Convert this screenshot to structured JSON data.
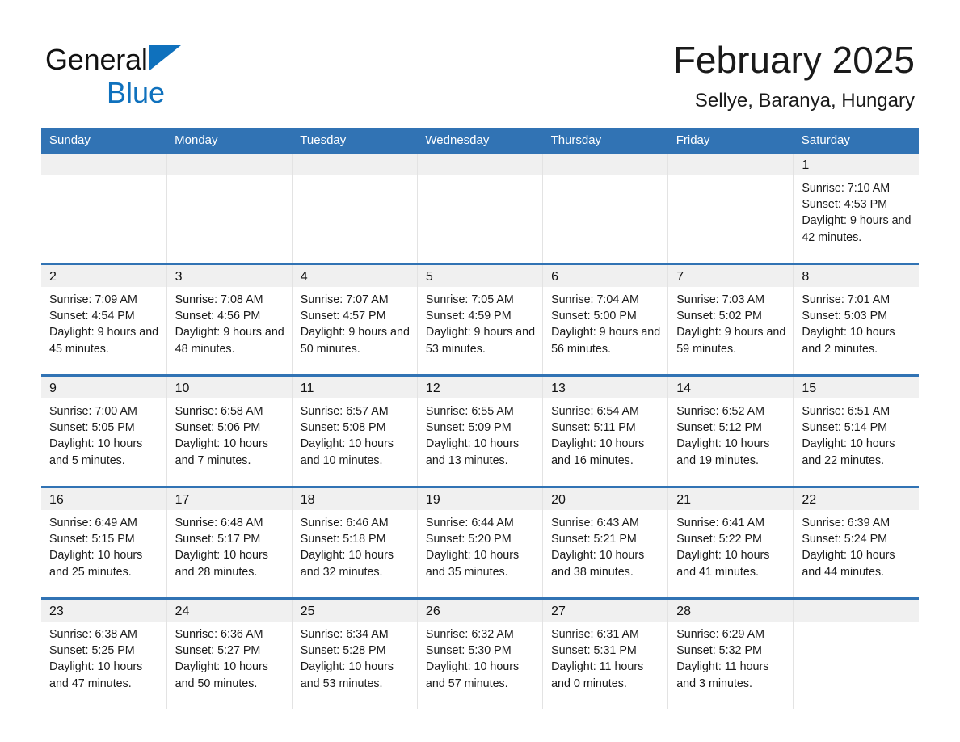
{
  "logo": {
    "word1": "General",
    "word2": "Blue",
    "triangle_icon": "triangle-icon",
    "blue": "#0f71bd"
  },
  "header": {
    "month_title": "February 2025",
    "location": "Sellye, Baranya, Hungary"
  },
  "colors": {
    "header_blue": "#3173b4",
    "row_divider_blue": "#3173b4",
    "daynum_band": "#f0f0f0",
    "text": "#1a1a1a"
  },
  "weekday_headers": [
    "Sunday",
    "Monday",
    "Tuesday",
    "Wednesday",
    "Thursday",
    "Friday",
    "Saturday"
  ],
  "weeks": [
    [
      {
        "day": "",
        "empty": true
      },
      {
        "day": "",
        "empty": true
      },
      {
        "day": "",
        "empty": true
      },
      {
        "day": "",
        "empty": true
      },
      {
        "day": "",
        "empty": true
      },
      {
        "day": "",
        "empty": true
      },
      {
        "day": "1",
        "sunrise": "Sunrise: 7:10 AM",
        "sunset": "Sunset: 4:53 PM",
        "daylight": "Daylight: 9 hours and 42 minutes."
      }
    ],
    [
      {
        "day": "2",
        "sunrise": "Sunrise: 7:09 AM",
        "sunset": "Sunset: 4:54 PM",
        "daylight": "Daylight: 9 hours and 45 minutes."
      },
      {
        "day": "3",
        "sunrise": "Sunrise: 7:08 AM",
        "sunset": "Sunset: 4:56 PM",
        "daylight": "Daylight: 9 hours and 48 minutes."
      },
      {
        "day": "4",
        "sunrise": "Sunrise: 7:07 AM",
        "sunset": "Sunset: 4:57 PM",
        "daylight": "Daylight: 9 hours and 50 minutes."
      },
      {
        "day": "5",
        "sunrise": "Sunrise: 7:05 AM",
        "sunset": "Sunset: 4:59 PM",
        "daylight": "Daylight: 9 hours and 53 minutes."
      },
      {
        "day": "6",
        "sunrise": "Sunrise: 7:04 AM",
        "sunset": "Sunset: 5:00 PM",
        "daylight": "Daylight: 9 hours and 56 minutes."
      },
      {
        "day": "7",
        "sunrise": "Sunrise: 7:03 AM",
        "sunset": "Sunset: 5:02 PM",
        "daylight": "Daylight: 9 hours and 59 minutes."
      },
      {
        "day": "8",
        "sunrise": "Sunrise: 7:01 AM",
        "sunset": "Sunset: 5:03 PM",
        "daylight": "Daylight: 10 hours and 2 minutes."
      }
    ],
    [
      {
        "day": "9",
        "sunrise": "Sunrise: 7:00 AM",
        "sunset": "Sunset: 5:05 PM",
        "daylight": "Daylight: 10 hours and 5 minutes."
      },
      {
        "day": "10",
        "sunrise": "Sunrise: 6:58 AM",
        "sunset": "Sunset: 5:06 PM",
        "daylight": "Daylight: 10 hours and 7 minutes."
      },
      {
        "day": "11",
        "sunrise": "Sunrise: 6:57 AM",
        "sunset": "Sunset: 5:08 PM",
        "daylight": "Daylight: 10 hours and 10 minutes."
      },
      {
        "day": "12",
        "sunrise": "Sunrise: 6:55 AM",
        "sunset": "Sunset: 5:09 PM",
        "daylight": "Daylight: 10 hours and 13 minutes."
      },
      {
        "day": "13",
        "sunrise": "Sunrise: 6:54 AM",
        "sunset": "Sunset: 5:11 PM",
        "daylight": "Daylight: 10 hours and 16 minutes."
      },
      {
        "day": "14",
        "sunrise": "Sunrise: 6:52 AM",
        "sunset": "Sunset: 5:12 PM",
        "daylight": "Daylight: 10 hours and 19 minutes."
      },
      {
        "day": "15",
        "sunrise": "Sunrise: 6:51 AM",
        "sunset": "Sunset: 5:14 PM",
        "daylight": "Daylight: 10 hours and 22 minutes."
      }
    ],
    [
      {
        "day": "16",
        "sunrise": "Sunrise: 6:49 AM",
        "sunset": "Sunset: 5:15 PM",
        "daylight": "Daylight: 10 hours and 25 minutes."
      },
      {
        "day": "17",
        "sunrise": "Sunrise: 6:48 AM",
        "sunset": "Sunset: 5:17 PM",
        "daylight": "Daylight: 10 hours and 28 minutes."
      },
      {
        "day": "18",
        "sunrise": "Sunrise: 6:46 AM",
        "sunset": "Sunset: 5:18 PM",
        "daylight": "Daylight: 10 hours and 32 minutes."
      },
      {
        "day": "19",
        "sunrise": "Sunrise: 6:44 AM",
        "sunset": "Sunset: 5:20 PM",
        "daylight": "Daylight: 10 hours and 35 minutes."
      },
      {
        "day": "20",
        "sunrise": "Sunrise: 6:43 AM",
        "sunset": "Sunset: 5:21 PM",
        "daylight": "Daylight: 10 hours and 38 minutes."
      },
      {
        "day": "21",
        "sunrise": "Sunrise: 6:41 AM",
        "sunset": "Sunset: 5:22 PM",
        "daylight": "Daylight: 10 hours and 41 minutes."
      },
      {
        "day": "22",
        "sunrise": "Sunrise: 6:39 AM",
        "sunset": "Sunset: 5:24 PM",
        "daylight": "Daylight: 10 hours and 44 minutes."
      }
    ],
    [
      {
        "day": "23",
        "sunrise": "Sunrise: 6:38 AM",
        "sunset": "Sunset: 5:25 PM",
        "daylight": "Daylight: 10 hours and 47 minutes."
      },
      {
        "day": "24",
        "sunrise": "Sunrise: 6:36 AM",
        "sunset": "Sunset: 5:27 PM",
        "daylight": "Daylight: 10 hours and 50 minutes."
      },
      {
        "day": "25",
        "sunrise": "Sunrise: 6:34 AM",
        "sunset": "Sunset: 5:28 PM",
        "daylight": "Daylight: 10 hours and 53 minutes."
      },
      {
        "day": "26",
        "sunrise": "Sunrise: 6:32 AM",
        "sunset": "Sunset: 5:30 PM",
        "daylight": "Daylight: 10 hours and 57 minutes."
      },
      {
        "day": "27",
        "sunrise": "Sunrise: 6:31 AM",
        "sunset": "Sunset: 5:31 PM",
        "daylight": "Daylight: 11 hours and 0 minutes."
      },
      {
        "day": "28",
        "sunrise": "Sunrise: 6:29 AM",
        "sunset": "Sunset: 5:32 PM",
        "daylight": "Daylight: 11 hours and 3 minutes."
      },
      {
        "day": "",
        "empty": true
      }
    ]
  ]
}
